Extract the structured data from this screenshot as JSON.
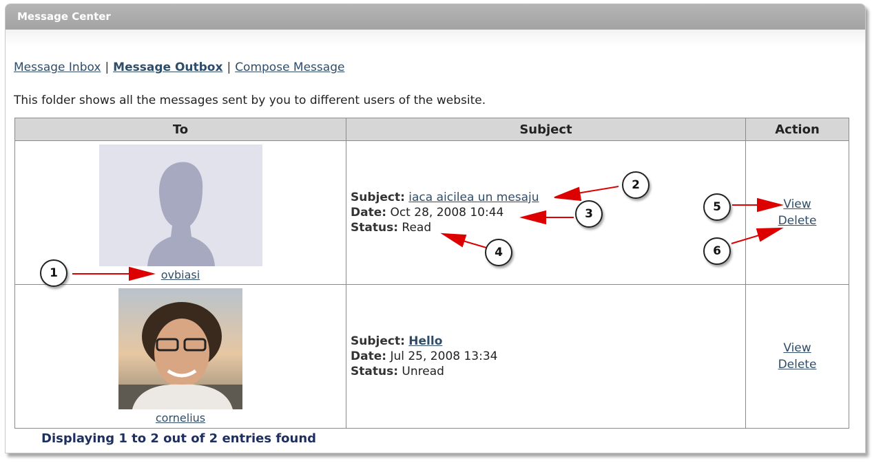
{
  "panel": {
    "title": "Message Center"
  },
  "nav": {
    "inbox": "Message Inbox",
    "outbox": "Message Outbox",
    "compose": "Compose Message",
    "separator": "|"
  },
  "description": "This folder shows all the messages sent by you to different users of the website.",
  "table": {
    "headers": {
      "to": "To",
      "subject": "Subject",
      "action": "Action"
    },
    "labels": {
      "subject": "Subject:",
      "date": "Date:",
      "status": "Status:"
    },
    "rows": [
      {
        "user": "ovbiasi",
        "avatar": "default-silhouette",
        "subject": "iaca aicilea un mesaju",
        "date": "Oct 28, 2008 10:44",
        "status": "Read",
        "view": "View",
        "delete": "Delete"
      },
      {
        "user": "cornelius",
        "avatar": "user-photo",
        "subject": "Hello",
        "date": "Jul 25, 2008 13:34",
        "status": "Unread",
        "view": "View",
        "delete": "Delete"
      }
    ]
  },
  "footer": {
    "count_text": "Displaying 1 to 2 out of 2 entries found"
  },
  "callouts": [
    "1",
    "2",
    "3",
    "4",
    "5",
    "6"
  ],
  "colors": {
    "header_bg": "#aaaaaa",
    "link": "#2f4d69",
    "footer_text": "#1c2f5e",
    "arrow": "#dd0000",
    "table_header_bg": "#d6d6d6"
  }
}
